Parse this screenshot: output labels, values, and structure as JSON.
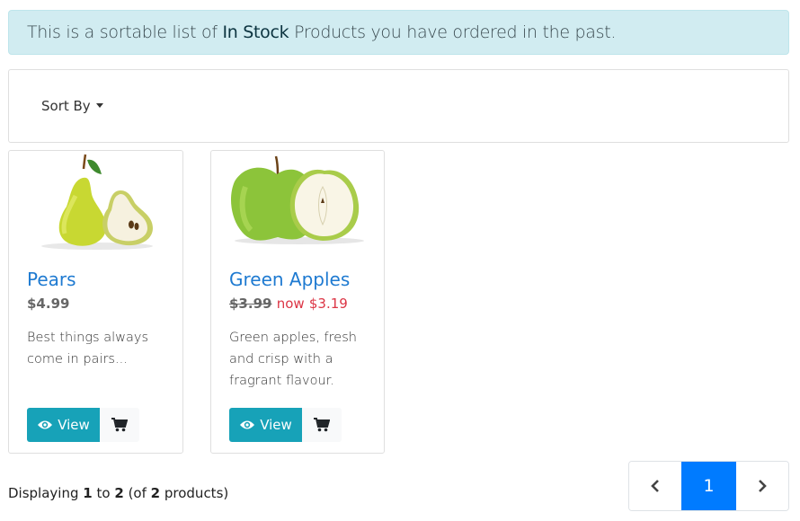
{
  "alert": {
    "prefix": "This is a sortable list of ",
    "emphasis": "In Stock",
    "suffix": " Products you have ordered in the past."
  },
  "sort": {
    "label": "Sort By"
  },
  "products": [
    {
      "name": "Pears",
      "price": "$4.99",
      "description": "Best things always come in pairs...",
      "view_label": "View",
      "image": "pear-image"
    },
    {
      "name": "Green Apples",
      "old_price": "$3.99",
      "now_label": "now",
      "new_price": "$3.19",
      "description": "Green apples, fresh and crisp with a fragrant flavour.",
      "view_label": "View",
      "image": "apple-image"
    }
  ],
  "footer": {
    "displaying": "Displaying",
    "from": "1",
    "to_word": "to",
    "to": "2",
    "of_open": "(of",
    "total": "2",
    "products_close": "products)"
  },
  "pagination": {
    "current": "1"
  },
  "colors": {
    "accent": "#17a2b8",
    "link": "#1e7ad1",
    "sale": "#dc3545",
    "page_active": "#007bff",
    "alert_bg": "#d1ecf1"
  }
}
